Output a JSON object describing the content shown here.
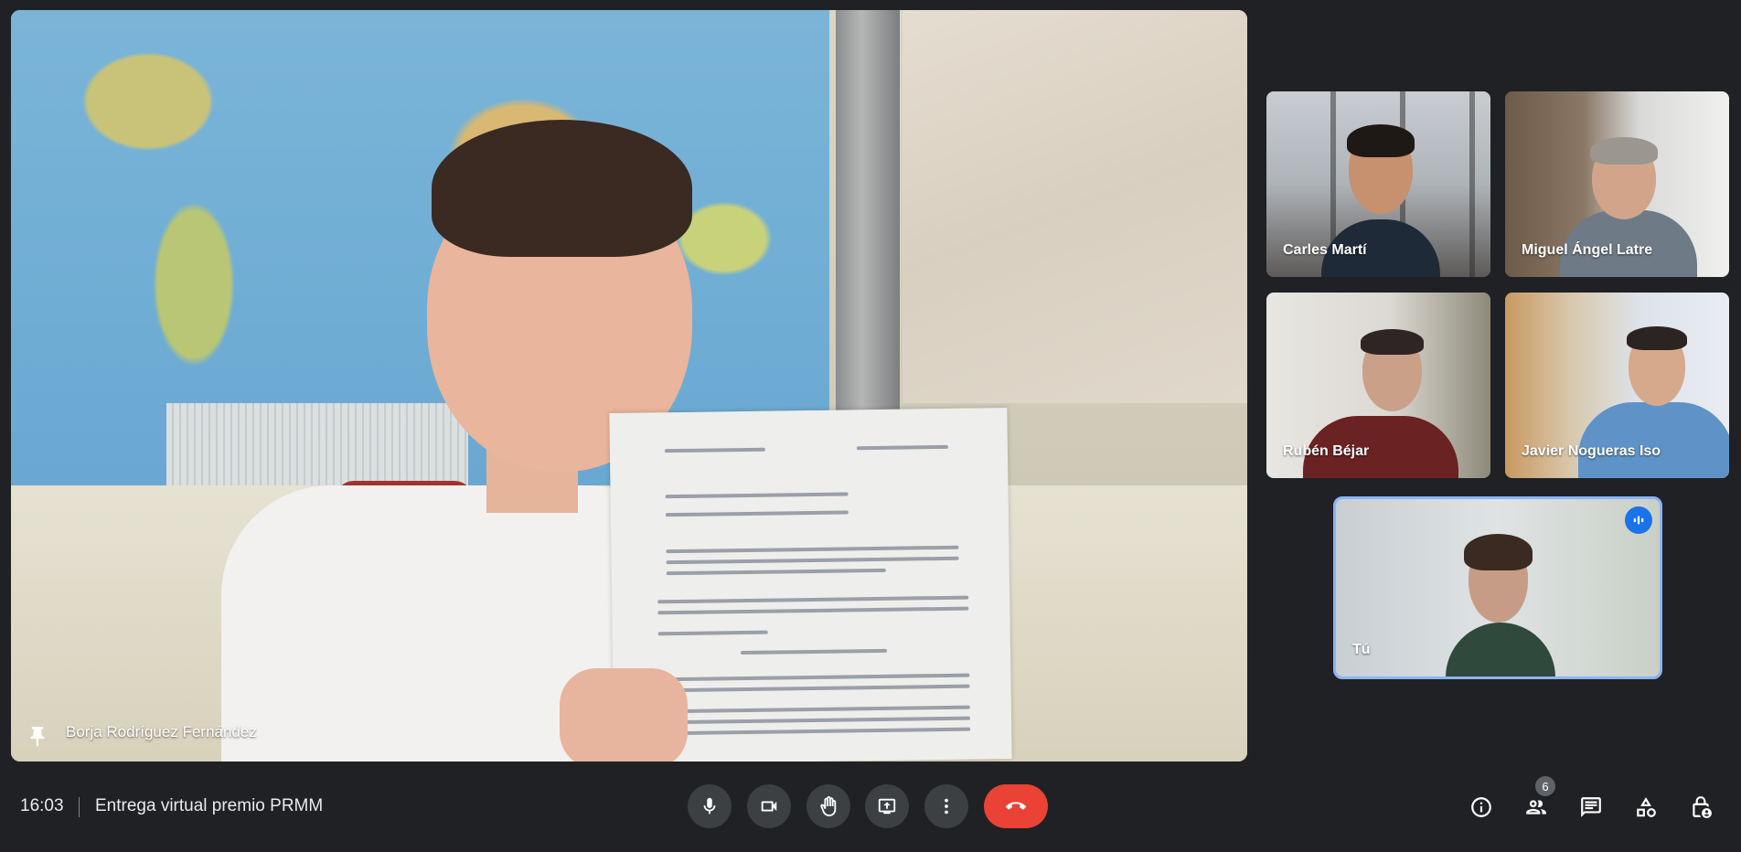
{
  "main_speaker": {
    "name": "Borja Rodríguez Fernández",
    "pin_icon": "pin-icon"
  },
  "participants": [
    {
      "name": "Carles Martí"
    },
    {
      "name": "Miguel Ángel Latre"
    },
    {
      "name": "Rubén Béjar"
    },
    {
      "name": "Javier Nogueras Iso"
    },
    {
      "name": "Tú",
      "speaking_icon": "audio-level-icon"
    }
  ],
  "meeting": {
    "time": "16:03",
    "title": "Entrega virtual premio PRMM"
  },
  "controls": [
    {
      "name": "microphone",
      "icon": "mic-icon"
    },
    {
      "name": "camera",
      "icon": "camera-icon"
    },
    {
      "name": "raise-hand",
      "icon": "hand-icon"
    },
    {
      "name": "present",
      "icon": "present-screen-icon"
    },
    {
      "name": "more-options",
      "icon": "more-vert-icon"
    },
    {
      "name": "leave-call",
      "icon": "call-end-icon"
    }
  ],
  "side_actions": [
    {
      "name": "meeting-details",
      "icon": "info-icon"
    },
    {
      "name": "people",
      "icon": "people-icon",
      "badge": "6"
    },
    {
      "name": "chat",
      "icon": "chat-icon"
    },
    {
      "name": "activities",
      "icon": "shapes-icon"
    },
    {
      "name": "host-controls",
      "icon": "lock-person-icon"
    }
  ],
  "colors": {
    "background": "#202124",
    "control_button": "#3c4043",
    "end_call": "#ea4335",
    "active_speaker_border": "#8ab4f8",
    "speaking_badge": "#1a73e8"
  }
}
